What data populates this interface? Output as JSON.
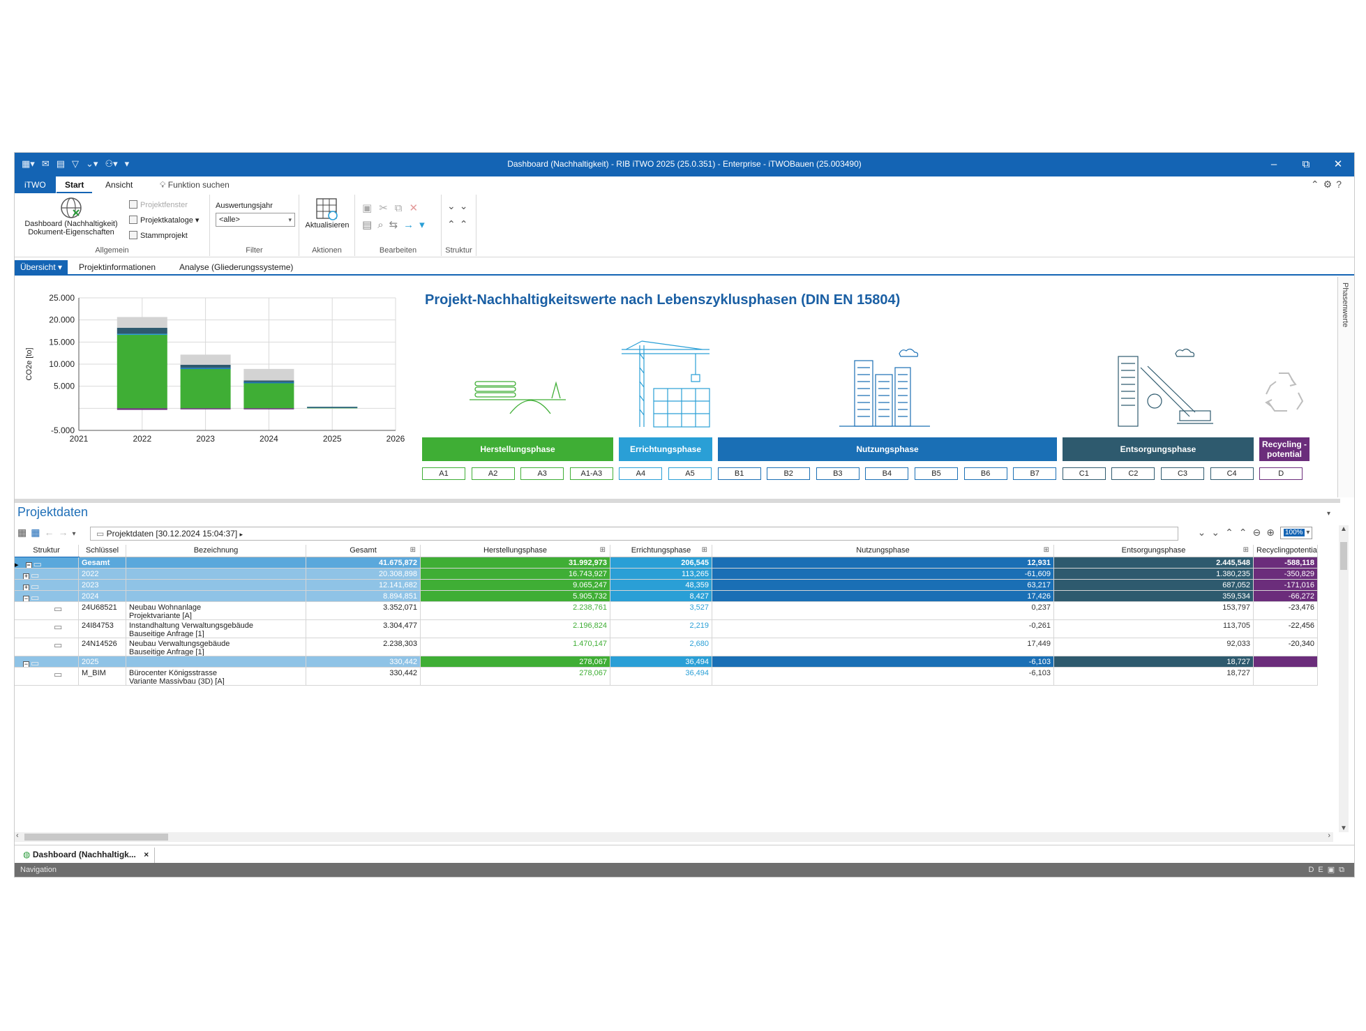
{
  "window": {
    "title": "Dashboard (Nachhaltigkeit) - RIB iTWO 2025 (25.0.351) - Enterprise - iTWOBauen (25.003490)",
    "minimize": "‒",
    "restore": "⧉",
    "close": "✕"
  },
  "ribbon_tabs": {
    "file": "iTWO",
    "start": "Start",
    "ansicht": "Ansicht",
    "search": "Funktion suchen"
  },
  "ribbon": {
    "dashboard_btn": [
      "Dashboard (Nachhaltigkeit)",
      "Dokument-Eigenschaften"
    ],
    "projektfenster": "Projektfenster",
    "projektkataloge": "Projektkataloge",
    "stammprojekt": "Stammprojekt",
    "allgemein": "Allgemein",
    "auswertungsjahr_label": "Auswertungsjahr",
    "auswertungsjahr_value": "<alle>",
    "filter": "Filter",
    "aktualisieren": "Aktualisieren",
    "aktionen": "Aktionen",
    "bearbeiten": "Bearbeiten",
    "struktur": "Struktur"
  },
  "view_tabs": {
    "uebersicht": "Übersicht",
    "projektinformationen": "Projektinformationen",
    "analyse": "Analyse (Gliederungssysteme)"
  },
  "side_tab": "Phasenwerte",
  "dashboard": {
    "heading": "Projekt-Nachhaltigkeitswerte nach Lebenszyklusphasen (DIN EN 15804)",
    "phases": {
      "herstellung": "Herstellungsphase",
      "errichtung": "Errichtungsphase",
      "nutzung": "Nutzungsphase",
      "entsorgung": "Entsorgungsphase",
      "recycling": "Recycling - potential"
    },
    "codes": [
      "A1",
      "A2",
      "A3",
      "A1-A3",
      "A4",
      "A5",
      "B1",
      "B2",
      "B3",
      "B4",
      "B5",
      "B6",
      "B7",
      "C1",
      "C2",
      "C3",
      "C4",
      "D"
    ]
  },
  "chart_data": {
    "type": "bar",
    "stacked": true,
    "categories": [
      "2022",
      "2023",
      "2024",
      "2025"
    ],
    "x_ticks": [
      "2021",
      "2022",
      "2023",
      "2024",
      "2025",
      "2026"
    ],
    "y_ticks": [
      "25.000",
      "20.000",
      "15.000",
      "10.000",
      "5.000",
      "-5.000"
    ],
    "ylabel": "CO2e [to]",
    "ylim": [
      -5000,
      25000
    ],
    "grid": true,
    "series": [
      {
        "color": "#3fae35",
        "values": [
          16743.927,
          9065.247,
          5905.732,
          278.067
        ]
      },
      {
        "color": "#2a9fd6",
        "values": [
          113.265,
          48.359,
          8.427,
          36.494
        ]
      },
      {
        "color": "#1a6fb5",
        "values": [
          0,
          63.217,
          17.426,
          0
        ]
      },
      {
        "color": "#2e5a6e",
        "values": [
          1380.235,
          687.052,
          359.534,
          18.727
        ]
      },
      {
        "color": "#d3d3d3",
        "values": [
          2425,
          2290,
          2620,
          0
        ]
      },
      {
        "color": "#6b2d7b",
        "values": [
          -350.829,
          -171.016,
          -66.272,
          0
        ]
      }
    ]
  },
  "projektdaten": {
    "title": "Projektdaten",
    "path": "Projektdaten [30.12.2024 15:04:37]",
    "zoom": "100%",
    "columns": [
      "Struktur",
      "Schlüssel",
      "Bezeichnung",
      "Gesamt",
      "Herstellungsphase",
      "Errichtungsphase",
      "Nutzungsphase",
      "Entsorgungsphase",
      "Recyclingpotential"
    ],
    "rows": [
      {
        "marker": "▸",
        "toggle": "−",
        "key": "Gesamt",
        "name": "",
        "gesamt": "41.675,872",
        "herst": "31.992,973",
        "err": "206,545",
        "nutz": "12,931",
        "ents": "2.445,548",
        "rec": "-588,118"
      },
      {
        "marker": "",
        "toggle": "+",
        "key": "2022",
        "name": "",
        "gesamt": "20.308,898",
        "herst": "16.743,927",
        "err": "113,265",
        "nutz": "-61,609",
        "ents": "1.380,235",
        "rec": "-350,829"
      },
      {
        "marker": "",
        "toggle": "+",
        "key": "2023",
        "name": "",
        "gesamt": "12.141,682",
        "herst": "9.065,247",
        "err": "48,359",
        "nutz": "63,217",
        "ents": "687,052",
        "rec": "-171,016"
      },
      {
        "marker": "",
        "toggle": "−",
        "key": "2024",
        "name": "",
        "gesamt": "8.894,851",
        "herst": "5.905,732",
        "err": "8,427",
        "nutz": "17,426",
        "ents": "359,534",
        "rec": "-66,272"
      },
      {
        "marker": "",
        "toggle": "",
        "key": "24U68521",
        "name": "Neubau Wohnanlage\nProjektvariante [A]",
        "gesamt": "3.352,071",
        "herst": "2.238,761",
        "err": "3,527",
        "nutz": "0,237",
        "ents": "153,797",
        "rec": "-23,476"
      },
      {
        "marker": "",
        "toggle": "",
        "key": "24I84753",
        "name": "Instandhaltung Verwaltungsgebäude\nBauseitige Anfrage [1]",
        "gesamt": "3.304,477",
        "herst": "2.196,824",
        "err": "2,219",
        "nutz": "-0,261",
        "ents": "113,705",
        "rec": "-22,456"
      },
      {
        "marker": "",
        "toggle": "",
        "key": "24N14526",
        "name": "Neubau Verwaltungsgebäude\nBauseitige Anfrage [1]",
        "gesamt": "2.238,303",
        "herst": "1.470,147",
        "err": "2,680",
        "nutz": "17,449",
        "ents": "92,033",
        "rec": "-20,340"
      },
      {
        "marker": "",
        "toggle": "−",
        "key": "2025",
        "name": "",
        "gesamt": "330,442",
        "herst": "278,067",
        "err": "36,494",
        "nutz": "-6,103",
        "ents": "18,727",
        "rec": ""
      },
      {
        "marker": "",
        "toggle": "",
        "key": "M_BIM",
        "name": "Bürocenter Königsstrasse\nVariante Massivbau (3D) [A]",
        "gesamt": "330,442",
        "herst": "278,067",
        "err": "36,494",
        "nutz": "-6,103",
        "ents": "18,727",
        "rec": ""
      }
    ]
  },
  "doc_tab": {
    "label": "Dashboard (Nachhaltigk...",
    "close": "×"
  },
  "status": {
    "navigation": "Navigation",
    "lang": "DE"
  },
  "colors": {
    "brand": "#1464b4",
    "herstellung": "#3fae35",
    "errichtung": "#2a9fd6",
    "nutzung": "#1a6fb5",
    "entsorgung": "#2e5a6e",
    "recycling": "#6b2d7b"
  }
}
